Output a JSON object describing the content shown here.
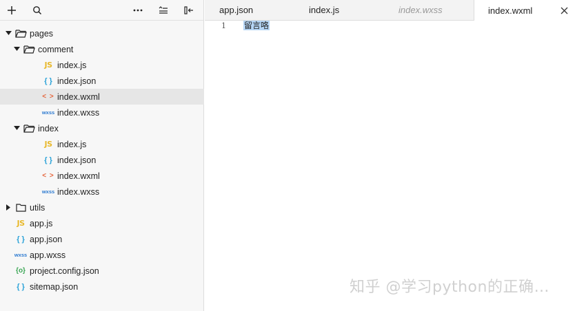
{
  "sidebar": {
    "tree": [
      {
        "label": "pages",
        "type": "folder",
        "depth": 0,
        "expanded": true
      },
      {
        "label": "comment",
        "type": "folder",
        "depth": 1,
        "expanded": true
      },
      {
        "label": "index.js",
        "type": "js",
        "depth": 2
      },
      {
        "label": "index.json",
        "type": "json",
        "depth": 2
      },
      {
        "label": "index.wxml",
        "type": "wxml",
        "depth": 2,
        "selected": true
      },
      {
        "label": "index.wxss",
        "type": "wxss",
        "depth": 2
      },
      {
        "label": "index",
        "type": "folder",
        "depth": 1,
        "expanded": true
      },
      {
        "label": "index.js",
        "type": "js",
        "depth": 2
      },
      {
        "label": "index.json",
        "type": "json",
        "depth": 2
      },
      {
        "label": "index.wxml",
        "type": "wxml",
        "depth": 2
      },
      {
        "label": "index.wxss",
        "type": "wxss",
        "depth": 2
      },
      {
        "label": "utils",
        "type": "folder",
        "depth": 0,
        "expanded": false
      },
      {
        "label": "app.js",
        "type": "js",
        "depth": 0
      },
      {
        "label": "app.json",
        "type": "json",
        "depth": 0
      },
      {
        "label": "app.wxss",
        "type": "wxss",
        "depth": 0
      },
      {
        "label": "project.config.json",
        "type": "config",
        "depth": 0
      },
      {
        "label": "sitemap.json",
        "type": "json",
        "depth": 0
      }
    ],
    "icon_glyphs": {
      "js": "JS",
      "json": "{ }",
      "wxml": "< >",
      "wxss": "wxss",
      "config": "{o}"
    }
  },
  "tabs": [
    {
      "label": "app.json",
      "italic": false,
      "active": false
    },
    {
      "label": "index.js",
      "italic": false,
      "active": false
    },
    {
      "label": "index.wxss",
      "italic": true,
      "active": false
    },
    {
      "label": "index.wxml",
      "italic": false,
      "active": true
    }
  ],
  "editor": {
    "line_number": "1",
    "code": "留言咯"
  },
  "watermark": "知乎 @学习python的正确…",
  "colors": {
    "selection": "#b5d5f5",
    "js": "#e8b82a",
    "json": "#2aa2d8",
    "wxml": "#e5643a",
    "wxss": "#2b79d0",
    "config": "#3aa654"
  }
}
